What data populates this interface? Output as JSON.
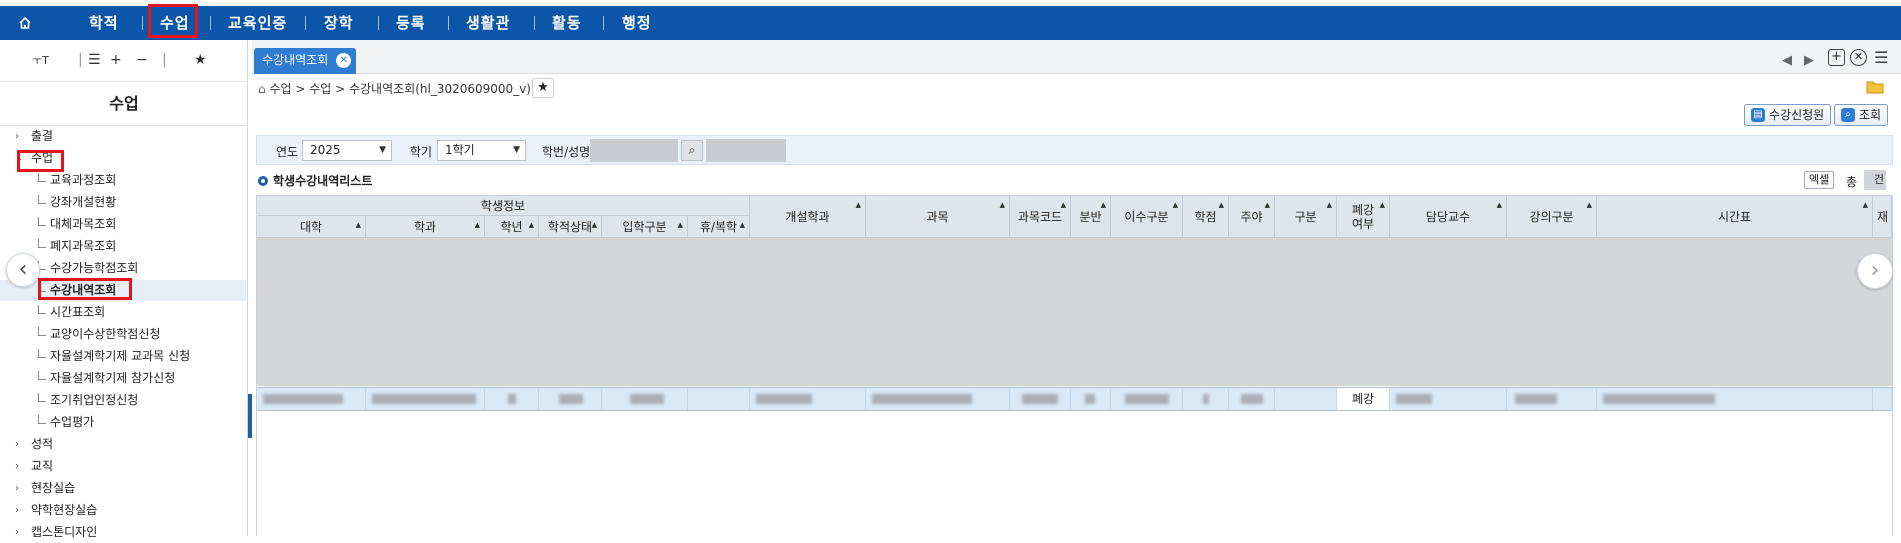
{
  "topnav": {
    "home_icon": "home-icon",
    "items": [
      {
        "label": "학적"
      },
      {
        "label": "수업"
      },
      {
        "label": "교육인증"
      },
      {
        "label": "장학"
      },
      {
        "label": "등록"
      },
      {
        "label": "생활관"
      },
      {
        "label": "활동"
      },
      {
        "label": "행정"
      }
    ],
    "separator": "|"
  },
  "sidebar": {
    "tools": {
      "font_size": "ㅜT",
      "plus": "+",
      "minus": "−",
      "star": "★"
    },
    "title": "수업",
    "tree": [
      {
        "label": "출결",
        "type": "group",
        "chev": "›"
      },
      {
        "label": "수업",
        "type": "group",
        "chev": "⌄"
      },
      {
        "label": "교육과정조회",
        "type": "child"
      },
      {
        "label": "강좌개설현황",
        "type": "child"
      },
      {
        "label": "대체과목조회",
        "type": "child"
      },
      {
        "label": "폐지과목조회",
        "type": "child"
      },
      {
        "label": "수강가능학점조회",
        "type": "child"
      },
      {
        "label": "수강내역조회",
        "type": "child"
      },
      {
        "label": "시간표조회",
        "type": "child"
      },
      {
        "label": "교양이수상한학점신청",
        "type": "child"
      },
      {
        "label": "자율설계학기제 교과목 신청",
        "type": "child"
      },
      {
        "label": "자율설계학기제 참가신청",
        "type": "child"
      },
      {
        "label": "조기취업인정신청",
        "type": "child"
      },
      {
        "label": "수업평가",
        "type": "child"
      },
      {
        "label": "성적",
        "type": "group",
        "chev": "›"
      },
      {
        "label": "교직",
        "type": "group",
        "chev": "›"
      },
      {
        "label": "현장실습",
        "type": "group",
        "chev": "›"
      },
      {
        "label": "약학현장실습",
        "type": "group",
        "chev": "›"
      },
      {
        "label": "캡스톤디자인",
        "type": "group",
        "chev": "›"
      }
    ]
  },
  "tab": {
    "label": "수강내역조회",
    "close": "✕"
  },
  "breadcrumb": {
    "home": "⌂",
    "text": "수업 > 수업 > 수강내역조회(hl_3020609000_v)"
  },
  "toolbar": {
    "apply_label": "수강신청원",
    "search_label": "조회"
  },
  "search": {
    "year_label": "연도",
    "year_value": "2025",
    "term_label": "학기",
    "term_value": "1학기",
    "student_label": "학번/성명"
  },
  "grid": {
    "title": "학생수강내역리스트",
    "excel_label": "엑셀",
    "total_label": "총",
    "total_value": "건",
    "headers": {
      "group_student": "학생정보",
      "univ": "대학",
      "dept": "학과",
      "grade": "학년",
      "status": "학적상태",
      "entry": "입학구분",
      "leave": "휴/복학",
      "open_dept": "개설학과",
      "course": "과목",
      "course_code": "과목코드",
      "section": "분반",
      "completion": "이수구분",
      "credit": "학점",
      "day_night": "주야",
      "category": "구분",
      "cancel": "폐강\n여부",
      "professor": "담당교수",
      "lecture_type": "강의구분",
      "timetable": "시간표",
      "extra": "재"
    },
    "row": {
      "cancel": "폐강"
    }
  }
}
